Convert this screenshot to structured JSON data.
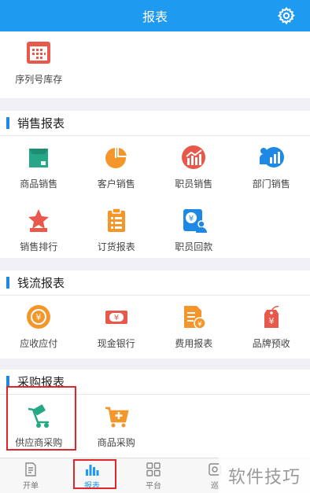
{
  "header": {
    "title": "报表",
    "settings_icon": "gear-icon"
  },
  "top_section": {
    "items": [
      {
        "label": "序列号库存",
        "icon": "serial-inventory-icon",
        "color": "#e8584b"
      }
    ]
  },
  "sections": [
    {
      "title": "销售报表",
      "items": [
        {
          "label": "商品销售",
          "icon": "product-box-icon",
          "color": "#26a886"
        },
        {
          "label": "客户销售",
          "icon": "pie-chart-icon",
          "color": "#f5962b"
        },
        {
          "label": "职员销售",
          "icon": "bar-chart-icon",
          "color": "#e8584b"
        },
        {
          "label": "部门销售",
          "icon": "department-chart-icon",
          "color": "#1e88e5"
        },
        {
          "label": "销售排行",
          "icon": "star-rank-icon",
          "color": "#e8584b"
        },
        {
          "label": "订货报表",
          "icon": "clipboard-icon",
          "color": "#f5962b"
        },
        {
          "label": "职员回款",
          "icon": "staff-payment-icon",
          "color": "#1e88e5"
        }
      ]
    },
    {
      "title": "钱流报表",
      "items": [
        {
          "label": "应收应付",
          "icon": "exchange-money-icon",
          "color": "#f5962b"
        },
        {
          "label": "现金银行",
          "icon": "banknote-icon",
          "color": "#e8584b"
        },
        {
          "label": "费用报表",
          "icon": "expense-doc-icon",
          "color": "#f5962b"
        },
        {
          "label": "品牌预收",
          "icon": "price-tag-icon",
          "color": "#e8584b"
        }
      ]
    },
    {
      "title": "采购报表",
      "items": [
        {
          "label": "供应商采购",
          "icon": "supplier-cart-icon",
          "color": "#26a886"
        },
        {
          "label": "商品采购",
          "icon": "shopping-cart-icon",
          "color": "#f5962b"
        }
      ]
    }
  ],
  "bottom_nav": [
    {
      "label": "开单",
      "icon": "document-icon"
    },
    {
      "label": "报表",
      "icon": "report-bars-icon",
      "active": true
    },
    {
      "label": "平台",
      "icon": "grid-icon"
    },
    {
      "label": "巡",
      "icon": "patrol-icon"
    }
  ],
  "watermark": "软件技巧",
  "colors": {
    "header": "#1e9bf0",
    "section_bar": "#1e88e5",
    "highlight": "#e0252b"
  }
}
